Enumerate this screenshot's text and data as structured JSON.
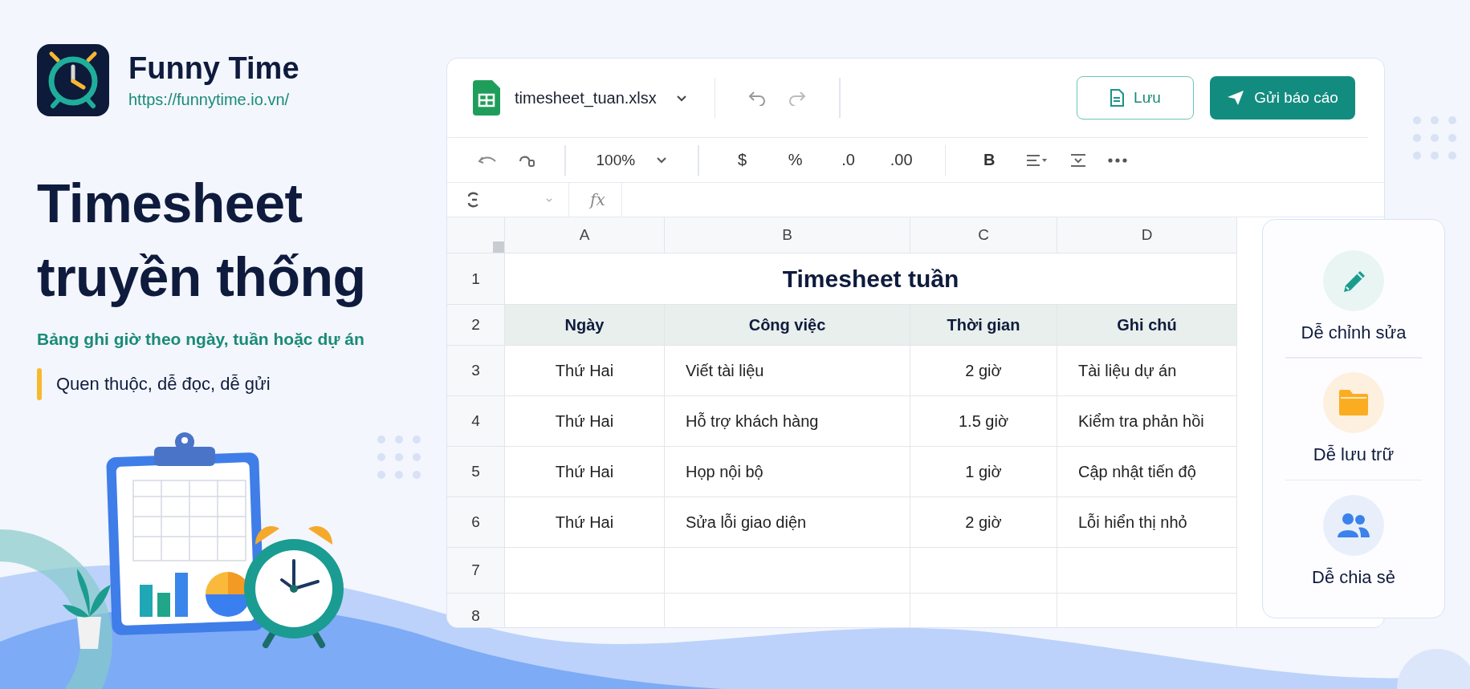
{
  "brand": {
    "name": "Funny Time",
    "url": "https://funnytime.io.vn/"
  },
  "headline": "Timesheet\ntruyền thống",
  "subtitle": "Bảng ghi giờ theo ngày, tuần hoặc dự án",
  "tagline": "Quen thuộc, dễ đọc, dễ gửi",
  "spreadsheet": {
    "file_name": "timesheet_tuan.xlsx",
    "buttons": [
      {
        "label": "Lưu",
        "kind": "secondary"
      },
      {
        "label": "Gửi báo cáo",
        "kind": "primary"
      }
    ],
    "zoom": "100%",
    "format_items": [
      "$",
      "%",
      ".0",
      ".00",
      "B"
    ],
    "formula_label": "fx",
    "columns": [
      "A",
      "B",
      "C",
      "D"
    ],
    "rows": [
      {
        "number": "1",
        "kind": "title",
        "cells": [
          "Timesheet tuần"
        ]
      },
      {
        "number": "2",
        "kind": "header",
        "cells": [
          "Ngày",
          "Công việc",
          "Thời gian",
          "Ghi chú"
        ]
      },
      {
        "number": "3",
        "kind": "data",
        "cells": [
          "Thứ Hai",
          "Viết tài liệu",
          "2 giờ",
          "Tài liệu dự án"
        ]
      },
      {
        "number": "4",
        "kind": "data",
        "cells": [
          "Thứ Hai",
          "Hỗ trợ khách hàng",
          "1.5 giờ",
          "Kiểm tra phản hồi"
        ]
      },
      {
        "number": "5",
        "kind": "data",
        "cells": [
          "Thứ Hai",
          "Họp nội bộ",
          "1 giờ",
          "Cập nhật tiến độ"
        ]
      },
      {
        "number": "6",
        "kind": "data",
        "cells": [
          "Thứ Hai",
          "Sửa lỗi giao diện",
          "2 giờ",
          "Lỗi hiển thị nhỏ"
        ]
      },
      {
        "number": "7",
        "kind": "empty",
        "cells": []
      },
      {
        "number": "8",
        "kind": "empty",
        "cells": []
      }
    ]
  },
  "features": [
    {
      "label": "Dễ chỉnh sửa",
      "kind": "edit"
    },
    {
      "label": "Dễ lưu trữ",
      "kind": "storage"
    },
    {
      "label": "Dễ chia sẻ",
      "kind": "share"
    }
  ]
}
